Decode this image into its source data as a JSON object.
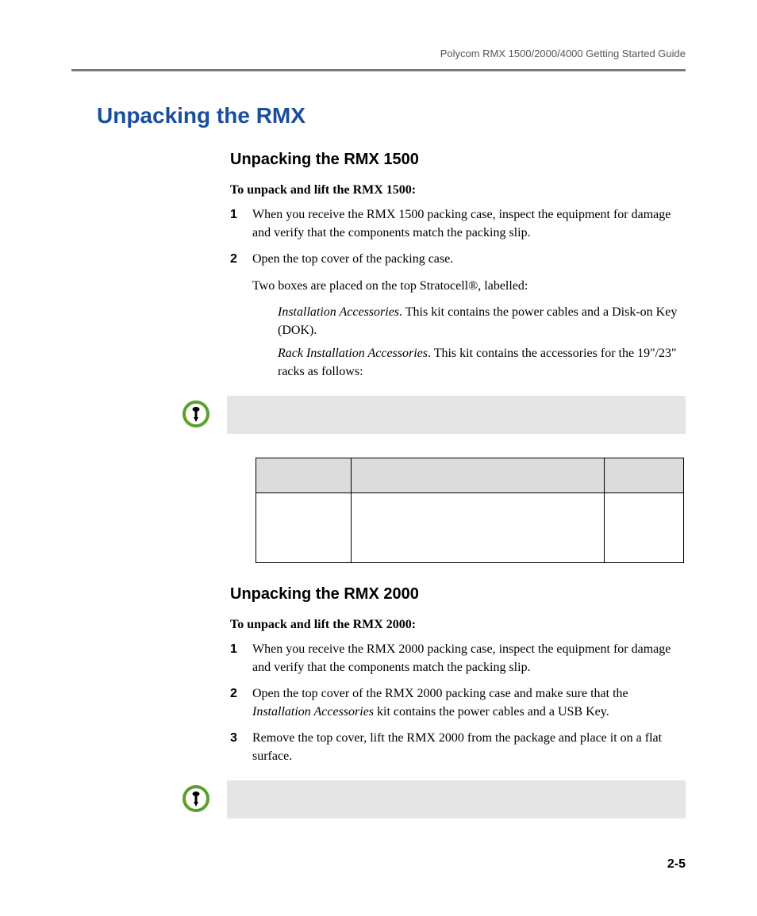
{
  "header": {
    "title": "Polycom RMX 1500/2000/4000 Getting Started Guide"
  },
  "h1": "Unpacking the RMX",
  "section1": {
    "h2": "Unpacking the RMX 1500",
    "lead": "To unpack and lift the RMX 1500:",
    "step1_num": "1",
    "step1": "When you receive the RMX 1500 packing case, inspect the equipment for damage and verify that the components match the packing slip.",
    "step2_num": "2",
    "step2": "Open the top cover of the packing case.",
    "para1": "Two boxes are placed on the top Stratocell®, labelled:",
    "indent1_italic": "Installation Accessories",
    "indent1_rest": ". This kit contains the power cables and a Disk-on Key (DOK).",
    "indent2_italic": "Rack Installation Accessories",
    "indent2_rest": ". This kit contains the accessories for the 19\"/23\" racks as follows:"
  },
  "section2": {
    "h2": "Unpacking the RMX 2000",
    "lead": "To unpack and lift the RMX 2000:",
    "step1_num": "1",
    "step1": "When you receive the RMX 2000 packing case, inspect the equipment for damage and verify that the components match the packing slip.",
    "step2_num": "2",
    "step2_a": "Open the top cover of the RMX 2000 packing case and make sure that the ",
    "step2_italic": "Installation Accessories",
    "step2_b": " kit contains the power cables and a USB Key.",
    "step3_num": "3",
    "step3": "Remove the top cover, lift the RMX 2000 from the package and place it on a flat surface."
  },
  "footer": {
    "page": "2-5"
  }
}
